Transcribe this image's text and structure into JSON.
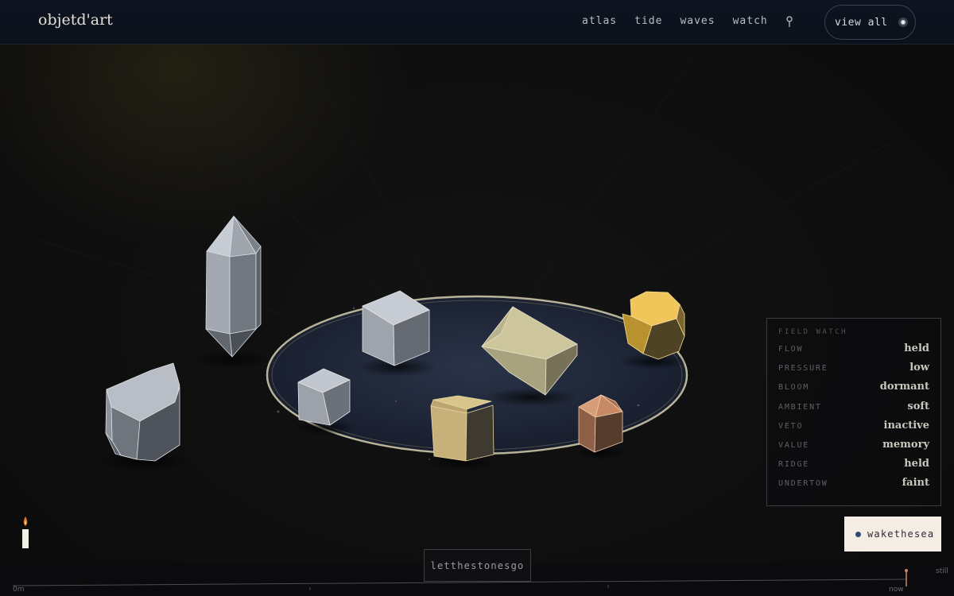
{
  "brand": {
    "name": "objetd'art"
  },
  "nav": {
    "items": [
      "atlas",
      "tide",
      "waves",
      "watch"
    ]
  },
  "icons": {
    "location": "map-pin-icon",
    "view_all": "sparkle-icon",
    "candle": "candle-icon",
    "wake": "dot-icon"
  },
  "view_all": {
    "label": "view all"
  },
  "field_watch": {
    "title": "FIELD WATCH",
    "rows": [
      {
        "key": "FLOW",
        "value": "held"
      },
      {
        "key": "PRESSURE",
        "value": "low"
      },
      {
        "key": "BLOOM",
        "value": "dormant"
      },
      {
        "key": "AMBIENT",
        "value": "soft"
      },
      {
        "key": "VETO",
        "value": "inactive"
      },
      {
        "key": "VALUE",
        "value": "memory"
      },
      {
        "key": "RIDGE",
        "value": "held"
      },
      {
        "key": "UNDERTOW",
        "value": "faint"
      }
    ]
  },
  "wake_button": {
    "label": "wakethesea"
  },
  "let_go_button": {
    "label": "letthestonesgo"
  },
  "timeline": {
    "start_label": "0m",
    "end_label": "now",
    "state_label": "still"
  },
  "colors": {
    "accent": "#2e4a6e",
    "wake_bg": "#f4ede3",
    "amber": "#f0c65a",
    "copper": "#c98a66"
  }
}
